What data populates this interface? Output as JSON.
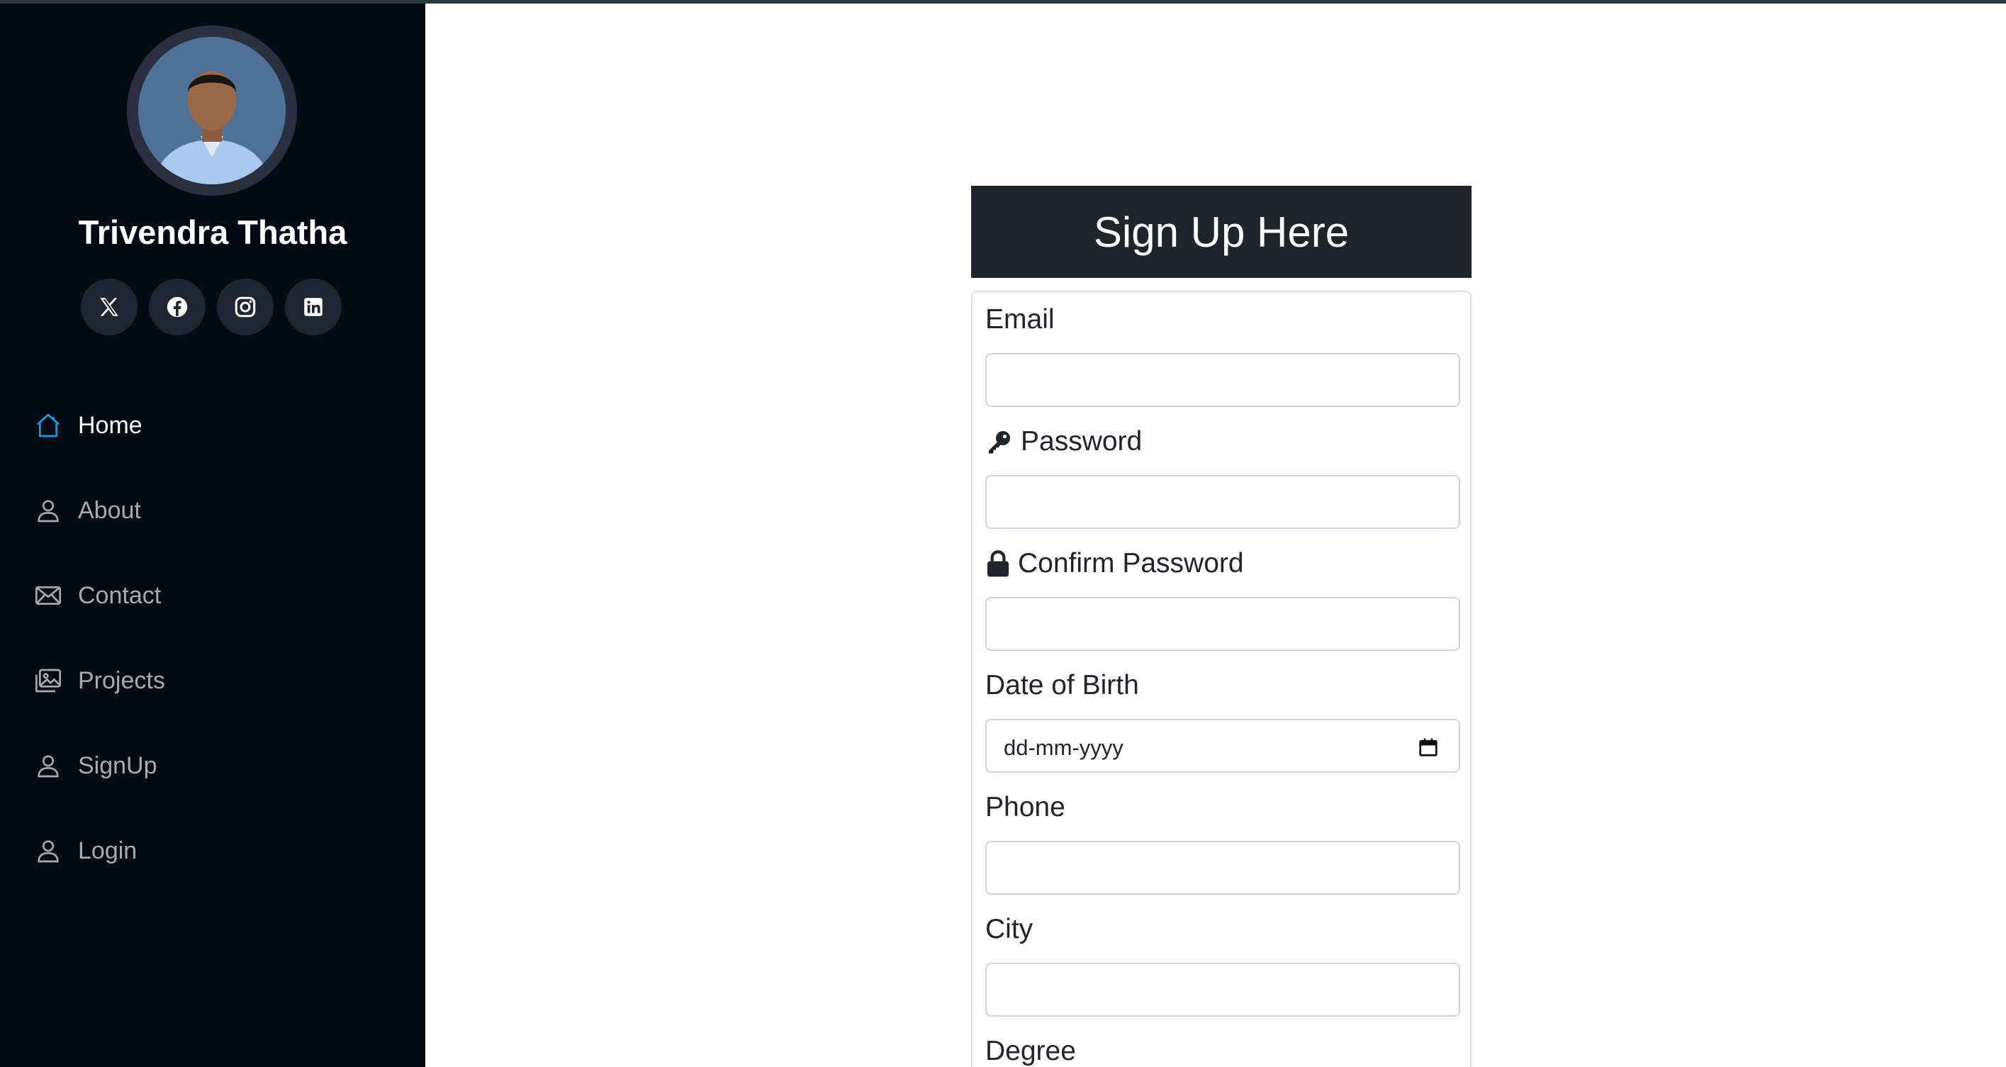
{
  "profile": {
    "name": "Trivendra Thatha",
    "photo_icon": "profile-photo"
  },
  "socials": [
    {
      "icon": "x-twitter-icon"
    },
    {
      "icon": "facebook-icon"
    },
    {
      "icon": "instagram-icon"
    },
    {
      "icon": "linkedin-icon"
    }
  ],
  "nav": {
    "items": [
      {
        "label": "Home",
        "icon": "house-icon",
        "active": true
      },
      {
        "label": "About",
        "icon": "person-icon"
      },
      {
        "label": "Contact",
        "icon": "envelope-icon"
      },
      {
        "label": "Projects",
        "icon": "images-icon"
      },
      {
        "label": "SignUp",
        "icon": "person-icon"
      },
      {
        "label": "Login",
        "icon": "person-icon"
      }
    ]
  },
  "form": {
    "title": "Sign Up Here",
    "fields": {
      "email": {
        "label": "Email",
        "value": ""
      },
      "password": {
        "label": "Password",
        "icon": "key-icon",
        "value": ""
      },
      "confirm_password": {
        "label": "Confirm Password",
        "icon": "lock-icon",
        "value": ""
      },
      "dob": {
        "label": "Date of Birth",
        "placeholder": "dd-mm-yyyy",
        "icon": "calendar-icon"
      },
      "phone": {
        "label": "Phone",
        "value": ""
      },
      "city": {
        "label": "City",
        "value": ""
      },
      "degree": {
        "label": "Degree"
      }
    }
  },
  "colors": {
    "sidebar_bg": "#040b14",
    "accent": "#149ddd",
    "title_bg": "#212529"
  }
}
